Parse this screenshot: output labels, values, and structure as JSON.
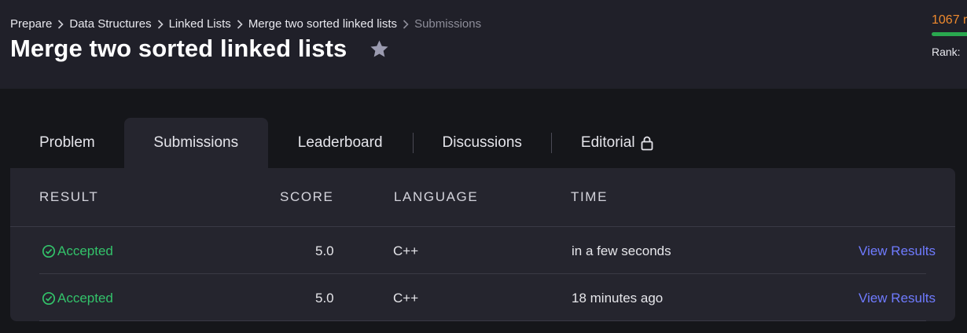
{
  "breadcrumb": {
    "items": [
      "Prepare",
      "Data Structures",
      "Linked Lists",
      "Merge two sorted linked lists"
    ],
    "current": "Submissions"
  },
  "page": {
    "title": "Merge two sorted linked lists"
  },
  "user_stats": {
    "score": "1067 r",
    "rank_label": "Rank:"
  },
  "tabs": [
    {
      "label": "Problem",
      "active": false
    },
    {
      "label": "Submissions",
      "active": true
    },
    {
      "label": "Leaderboard",
      "active": false
    },
    {
      "label": "Discussions",
      "active": false
    },
    {
      "label": "Editorial",
      "active": false,
      "locked": true
    }
  ],
  "table": {
    "headers": {
      "result": "RESULT",
      "score": "SCORE",
      "language": "LANGUAGE",
      "time": "TIME"
    },
    "rows": [
      {
        "status": "Accepted",
        "score": "5.0",
        "language": "C++",
        "time": "in a few seconds",
        "action": "View Results"
      },
      {
        "status": "Accepted",
        "score": "5.0",
        "language": "C++",
        "time": "18 minutes ago",
        "action": "View Results"
      }
    ]
  },
  "colors": {
    "accepted": "#33c26a",
    "link": "#6f7bff",
    "score": "#ef8a2e",
    "progress": "#2aa84f"
  },
  "icons": {
    "breadcrumb_separator": "chevron-right-icon",
    "favorite": "star-icon",
    "editorial_lock": "lock-icon",
    "accepted_status": "check-circle-icon"
  }
}
